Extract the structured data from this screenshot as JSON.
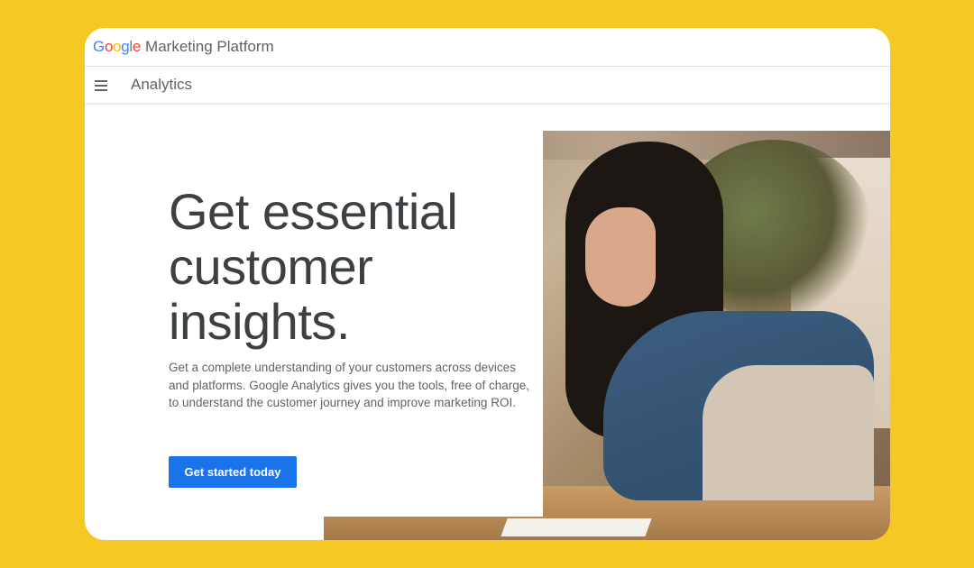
{
  "brand": {
    "google_letters": [
      "G",
      "o",
      "o",
      "g",
      "l",
      "e"
    ],
    "platform": "Marketing Platform"
  },
  "nav": {
    "menu_icon": "hamburger-menu-icon",
    "product_name": "Analytics"
  },
  "hero": {
    "headline": "Get essential customer insights.",
    "description": "Get a complete understanding of your customers across devices and platforms. Google Analytics gives you the tools, free of charge, to understand the customer journey and improve marketing ROI.",
    "cta_label": "Get started today"
  },
  "colors": {
    "page_background": "#F5C823",
    "cta_background": "#1a73e8",
    "headline_text": "#3c4043",
    "google_blue": "#4285F4",
    "google_red": "#EA4335",
    "google_yellow": "#FBBC05",
    "google_green": "#34A853"
  }
}
